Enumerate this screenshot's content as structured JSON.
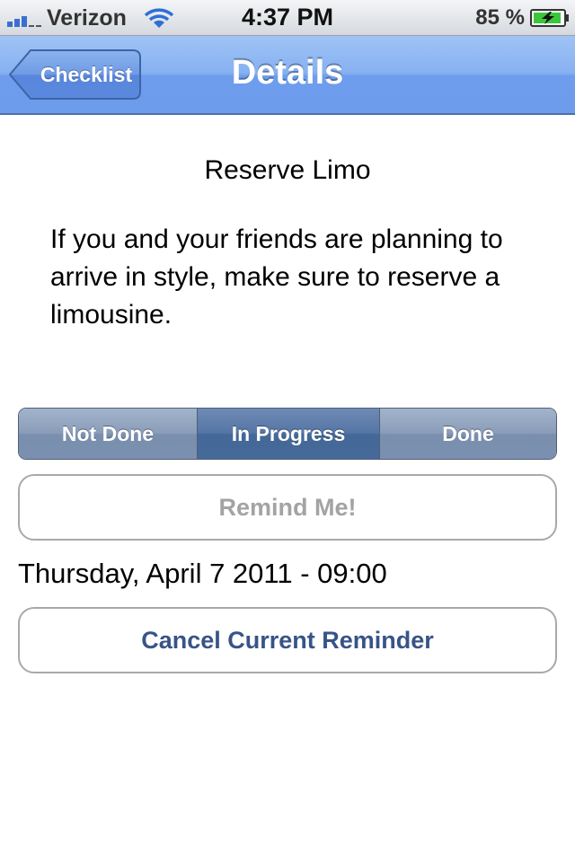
{
  "status_bar": {
    "carrier": "Verizon",
    "time": "4:37 PM",
    "battery_percent": "85 %",
    "signal_icon": "signal-bars-icon",
    "wifi_icon": "wifi-icon",
    "battery_icon": "battery-charging-icon"
  },
  "nav": {
    "back_label": "Checklist",
    "title": "Details"
  },
  "item": {
    "title": "Reserve Limo",
    "description": "If you and your friends are planning to arrive in style, make sure to reserve a limousine."
  },
  "status_control": {
    "segments": [
      "Not Done",
      "In Progress",
      "Done"
    ],
    "selected": "In Progress"
  },
  "reminder": {
    "remind_label": "Remind Me!",
    "date_text": "Thursday, April 7 2011 - 09:00",
    "cancel_label": "Cancel Current Reminder"
  },
  "colors": {
    "nav_bar": "#7aa5ee",
    "segment_selected": "#4f6f9e",
    "cancel_text": "#385487",
    "disabled_text": "#a3a3a3"
  }
}
